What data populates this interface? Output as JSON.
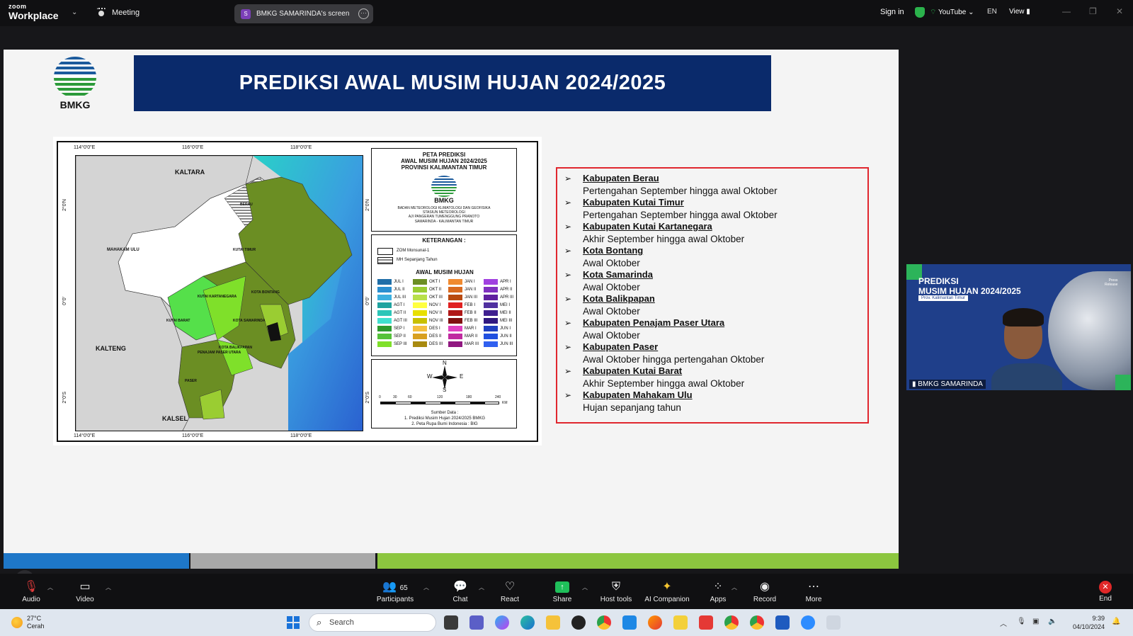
{
  "topbar": {
    "logo_small": "zoom",
    "logo_big": "Workplace",
    "meeting_label": "Meeting",
    "share_badge": "S",
    "share_label": "BMKG SAMARINDA's screen",
    "signin": "Sign in",
    "youtube": "YouTube",
    "lang": "EN",
    "view": "View"
  },
  "slide": {
    "logo_label": "BMKG",
    "title": "PREDIKSI AWAL MUSIM HUJAN 2024/2025",
    "map": {
      "coords_top": [
        "114°0'0\"E",
        "116°0'0\"E",
        "118°0'0\"E"
      ],
      "coords_bottom": [
        "114°0'0\"E",
        "116°0'0\"E",
        "118°0'0\"E"
      ],
      "coords_left": [
        "2°0'N",
        "0°0'",
        "2°0'S"
      ],
      "coords_right": [
        "2°0'N",
        "0°0'",
        "2°0'S"
      ],
      "labels": {
        "kaltara": "KALTARA",
        "kalteng": "KALTENG",
        "kalsel": "KALSEL",
        "mahakam": "MAHAKAM ULU",
        "kutai_timur": "KUTAI TIMUR",
        "kutai_kartanegara": "KUTAI KARTANEGARA",
        "bontang": "KOTA BONTANG",
        "kutai_barat": "KUTAI BARAT",
        "samarinda": "KOTA SAMARINDA",
        "balikpapan": "KOTA BALIKPAPAN",
        "ppu": "PENAJAM PASER UTARA",
        "paser": "PASER",
        "berau": "BERAU"
      },
      "legend_title": [
        "PETA PREDIKSI",
        "AWAL MUSIM HUJAN 2024/2025",
        "PROVINSI KALIMANTAN TIMUR"
      ],
      "legend_logo": "BMKG",
      "agency": [
        "BADAN METEOROLOGI KLIMATOLOGI DAN GEOFISIKA",
        "STASIUN METEOROLOGI",
        "AJI PANGERAN TUMENGGUNG PRANOTO",
        "SAMARINDA - KALIMANTAN TIMUR"
      ],
      "keterangan": "KETERANGAN :",
      "zom": "ZOM Monsunal-1",
      "mh": "MH Sepanjang Tahun",
      "awal": "AWAL MUSIM HUJAN",
      "dasarians": [
        {
          "label": "JUL I",
          "color": "#1f6ea8"
        },
        {
          "label": "JUL II",
          "color": "#2a8fd0"
        },
        {
          "label": "JUL III",
          "color": "#3bb0e0"
        },
        {
          "label": "AGT I",
          "color": "#1fa3a0"
        },
        {
          "label": "AGT II",
          "color": "#2cc6b8"
        },
        {
          "label": "AGT III",
          "color": "#40e0d0"
        },
        {
          "label": "SEP I",
          "color": "#2e9a2e"
        },
        {
          "label": "SEP II",
          "color": "#55c23a"
        },
        {
          "label": "SEP III",
          "color": "#7fe02a"
        },
        {
          "label": "OKT I",
          "color": "#6b8e23"
        },
        {
          "label": "OKT II",
          "color": "#9acd32"
        },
        {
          "label": "OKT III",
          "color": "#b8e04a"
        },
        {
          "label": "NOV I",
          "color": "#ffff40"
        },
        {
          "label": "NOV II",
          "color": "#e8e000"
        },
        {
          "label": "NOV III",
          "color": "#c8c000"
        },
        {
          "label": "DES I",
          "color": "#f5c040"
        },
        {
          "label": "DES II",
          "color": "#d8a020"
        },
        {
          "label": "DES III",
          "color": "#a88a10"
        },
        {
          "label": "JAN I",
          "color": "#f08a30"
        },
        {
          "label": "JAN II",
          "color": "#d86a20"
        },
        {
          "label": "JAN III",
          "color": "#b84a10"
        },
        {
          "label": "FEB I",
          "color": "#e02020"
        },
        {
          "label": "FEB II",
          "color": "#b01818"
        },
        {
          "label": "FEB III",
          "color": "#801010"
        },
        {
          "label": "MAR I",
          "color": "#e040c0"
        },
        {
          "label": "MAR II",
          "color": "#c02aa0"
        },
        {
          "label": "MAR III",
          "color": "#901880"
        },
        {
          "label": "APR I",
          "color": "#a040e0"
        },
        {
          "label": "APR II",
          "color": "#8030c0"
        },
        {
          "label": "APR III",
          "color": "#6020a0"
        },
        {
          "label": "MEI I",
          "color": "#5030a0"
        },
        {
          "label": "MEI II",
          "color": "#402090"
        },
        {
          "label": "MEI III",
          "color": "#301880"
        },
        {
          "label": "JUN I",
          "color": "#2040c0"
        },
        {
          "label": "JUN II",
          "color": "#2050e0"
        },
        {
          "label": "JUN III",
          "color": "#3060f0"
        }
      ],
      "compass": {
        "n": "N",
        "s": "S",
        "e": "E",
        "w": "W"
      },
      "scale": [
        "0",
        "30",
        "60",
        "120",
        "180",
        "240"
      ],
      "scale_unit": "KM",
      "sumber_title": "Sumber Data :",
      "sumber": [
        "1. Prediksi Musim Hujan 2024/2025 BMKG",
        "2. Peta Rupa Bumi Indonesia : BIG"
      ]
    },
    "items": [
      {
        "name": "Kabupaten Berau",
        "desc": "Pertengahan September hingga awal Oktober"
      },
      {
        "name": "Kabupaten Kutai Timur",
        "desc": "Pertengahan September hingga awal Oktober"
      },
      {
        "name": "Kabupaten Kutai Kartanegara",
        "desc": "Akhir September hingga awal Oktober"
      },
      {
        "name": "Kota Bontang",
        "desc": "Awal Oktober"
      },
      {
        "name": "Kota Samarinda",
        "desc": "Awal Oktober"
      },
      {
        "name": "Kota Balikpapan",
        "desc": "Awal Oktober"
      },
      {
        "name": "Kabupaten Penajam Paser Utara",
        "desc": "Awal Oktober"
      },
      {
        "name": "Kabupaten Paser",
        "desc": "Awal Oktober hingga pertengahan Oktober"
      },
      {
        "name": "Kabupaten Kutai Barat",
        "desc": "Akhir September hingga awal Oktober"
      },
      {
        "name": "Kabupaten Mahakam Ulu",
        "desc": "Hujan sepanjang tahun"
      }
    ]
  },
  "video": {
    "title_line1": "PREDIKSI",
    "title_line2": "MUSIM HUJAN 2024/2025",
    "chip": "Prov. Kalimantan Timur",
    "press_line1": "Press",
    "press_line2": "Release",
    "name": "BMKG SAMARINDA"
  },
  "toolbar": {
    "audio": "Audio",
    "video": "Video",
    "participants": "Participants",
    "participants_count": "65",
    "chat": "Chat",
    "react": "React",
    "share": "Share",
    "host_tools": "Host tools",
    "ai": "AI Companion",
    "apps": "Apps",
    "record": "Record",
    "more": "More",
    "end": "End"
  },
  "taskbar": {
    "temp": "27°C",
    "weather": "Cerah",
    "search_placeholder": "Search",
    "time": "9:39",
    "date": "04/10/2024"
  }
}
